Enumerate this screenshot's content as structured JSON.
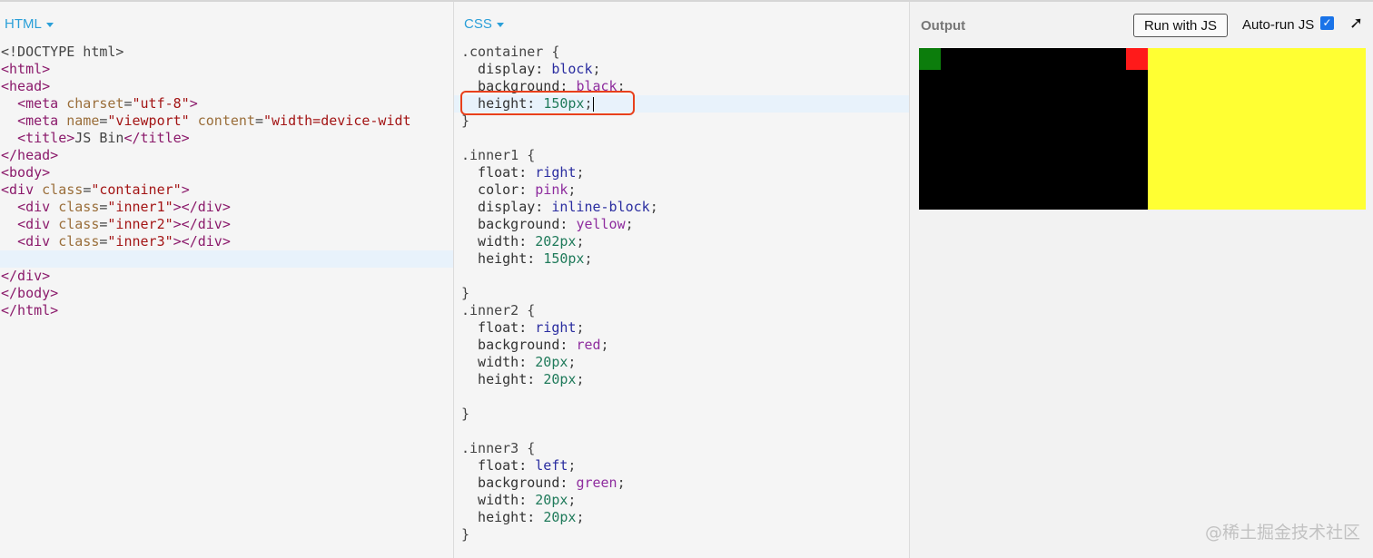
{
  "html_panel": {
    "label": "HTML",
    "lines": [
      [
        [
          "t-plain",
          "<!DOCTYPE html>"
        ]
      ],
      [
        [
          "t-tag",
          "<html>"
        ]
      ],
      [
        [
          "t-tag",
          "<head>"
        ]
      ],
      [
        [
          "t-plain",
          "  "
        ],
        [
          "t-tag",
          "<meta "
        ],
        [
          "t-attr",
          "charset"
        ],
        [
          "t-plain",
          "="
        ],
        [
          "t-str",
          "\"utf-8\""
        ],
        [
          "t-tag",
          ">"
        ]
      ],
      [
        [
          "t-plain",
          "  "
        ],
        [
          "t-tag",
          "<meta "
        ],
        [
          "t-attr",
          "name"
        ],
        [
          "t-plain",
          "="
        ],
        [
          "t-str",
          "\"viewport\""
        ],
        [
          "t-plain",
          " "
        ],
        [
          "t-attr",
          "content"
        ],
        [
          "t-plain",
          "="
        ],
        [
          "t-str",
          "\"width=device-widt"
        ]
      ],
      [
        [
          "t-plain",
          "  "
        ],
        [
          "t-tag",
          "<title>"
        ],
        [
          "t-plain",
          "JS Bin"
        ],
        [
          "t-tag",
          "</title>"
        ]
      ],
      [
        [
          "t-tag",
          "</head>"
        ]
      ],
      [
        [
          "t-tag",
          "<body>"
        ]
      ],
      [
        [
          "t-tag",
          "<div "
        ],
        [
          "t-attr",
          "class"
        ],
        [
          "t-plain",
          "="
        ],
        [
          "t-str",
          "\"container\""
        ],
        [
          "t-tag",
          ">"
        ]
      ],
      [
        [
          "t-plain",
          "  "
        ],
        [
          "t-tag",
          "<div "
        ],
        [
          "t-attr",
          "class"
        ],
        [
          "t-plain",
          "="
        ],
        [
          "t-str",
          "\"inner1\""
        ],
        [
          "t-tag",
          "></div>"
        ]
      ],
      [
        [
          "t-plain",
          "  "
        ],
        [
          "t-tag",
          "<div "
        ],
        [
          "t-attr",
          "class"
        ],
        [
          "t-plain",
          "="
        ],
        [
          "t-str",
          "\"inner2\""
        ],
        [
          "t-tag",
          "></div>"
        ]
      ],
      [
        [
          "t-plain",
          "  "
        ],
        [
          "t-tag",
          "<div "
        ],
        [
          "t-attr",
          "class"
        ],
        [
          "t-plain",
          "="
        ],
        [
          "t-str",
          "\"inner3\""
        ],
        [
          "t-tag",
          "></div>"
        ]
      ],
      [],
      [
        [
          "t-tag",
          "</div>"
        ]
      ],
      [
        [
          "t-tag",
          "</body>"
        ]
      ],
      [
        [
          "t-tag",
          "</html>"
        ]
      ]
    ],
    "active_line": 12
  },
  "css_panel": {
    "label": "CSS",
    "lines": [
      [
        [
          "t-plain",
          ".container {"
        ]
      ],
      [
        [
          "t-prop",
          "  display: "
        ],
        [
          "t-kw",
          "block"
        ],
        [
          "t-plain",
          ";"
        ]
      ],
      [
        [
          "t-prop",
          "  background: "
        ],
        [
          "t-color",
          "black"
        ],
        [
          "t-plain",
          ";"
        ]
      ],
      [
        [
          "t-prop",
          "  height: "
        ],
        [
          "t-num",
          "150px"
        ],
        [
          "t-plain",
          ";"
        ]
      ],
      [
        [
          "t-plain",
          "}"
        ]
      ],
      [],
      [
        [
          "t-plain",
          ".inner1 {"
        ]
      ],
      [
        [
          "t-prop",
          "  float: "
        ],
        [
          "t-kw",
          "right"
        ],
        [
          "t-plain",
          ";"
        ]
      ],
      [
        [
          "t-prop",
          "  color: "
        ],
        [
          "t-color",
          "pink"
        ],
        [
          "t-plain",
          ";"
        ]
      ],
      [
        [
          "t-prop",
          "  display: "
        ],
        [
          "t-kw",
          "inline-block"
        ],
        [
          "t-plain",
          ";"
        ]
      ],
      [
        [
          "t-prop",
          "  background: "
        ],
        [
          "t-color",
          "yellow"
        ],
        [
          "t-plain",
          ";"
        ]
      ],
      [
        [
          "t-prop",
          "  width: "
        ],
        [
          "t-num",
          "202px"
        ],
        [
          "t-plain",
          ";"
        ]
      ],
      [
        [
          "t-prop",
          "  height: "
        ],
        [
          "t-num",
          "150px"
        ],
        [
          "t-plain",
          ";"
        ]
      ],
      [],
      [
        [
          "t-plain",
          "}"
        ]
      ],
      [
        [
          "t-plain",
          ".inner2 {"
        ]
      ],
      [
        [
          "t-prop",
          "  float: "
        ],
        [
          "t-kw",
          "right"
        ],
        [
          "t-plain",
          ";"
        ]
      ],
      [
        [
          "t-prop",
          "  background: "
        ],
        [
          "t-color",
          "red"
        ],
        [
          "t-plain",
          ";"
        ]
      ],
      [
        [
          "t-prop",
          "  width: "
        ],
        [
          "t-num",
          "20px"
        ],
        [
          "t-plain",
          ";"
        ]
      ],
      [
        [
          "t-prop",
          "  height: "
        ],
        [
          "t-num",
          "20px"
        ],
        [
          "t-plain",
          ";"
        ]
      ],
      [],
      [
        [
          "t-plain",
          "}"
        ]
      ],
      [],
      [
        [
          "t-plain",
          ".inner3 {"
        ]
      ],
      [
        [
          "t-prop",
          "  float: "
        ],
        [
          "t-kw",
          "left"
        ],
        [
          "t-plain",
          ";"
        ]
      ],
      [
        [
          "t-prop",
          "  background: "
        ],
        [
          "t-color",
          "green"
        ],
        [
          "t-plain",
          ";"
        ]
      ],
      [
        [
          "t-prop",
          "  width: "
        ],
        [
          "t-num",
          "20px"
        ],
        [
          "t-plain",
          ";"
        ]
      ],
      [
        [
          "t-prop",
          "  height: "
        ],
        [
          "t-num",
          "20px"
        ],
        [
          "t-plain",
          ";"
        ]
      ],
      [
        [
          "t-plain",
          "}"
        ]
      ]
    ],
    "active_line": 3
  },
  "output_panel": {
    "title": "Output",
    "run_button": "Run with JS",
    "autorun_label": "Auto-run JS",
    "autorun_checked": true,
    "expand_icon": "expand-arrow-icon",
    "rendered_colors": {
      "container": "#000000",
      "inner1": "#ffff33",
      "inner2": "#ff1a1a",
      "inner3": "#0c7d0c"
    }
  },
  "watermark": "@稀土掘金技术社区",
  "accent_color": "#2a9fd8",
  "highlight_color": "#e8401c"
}
